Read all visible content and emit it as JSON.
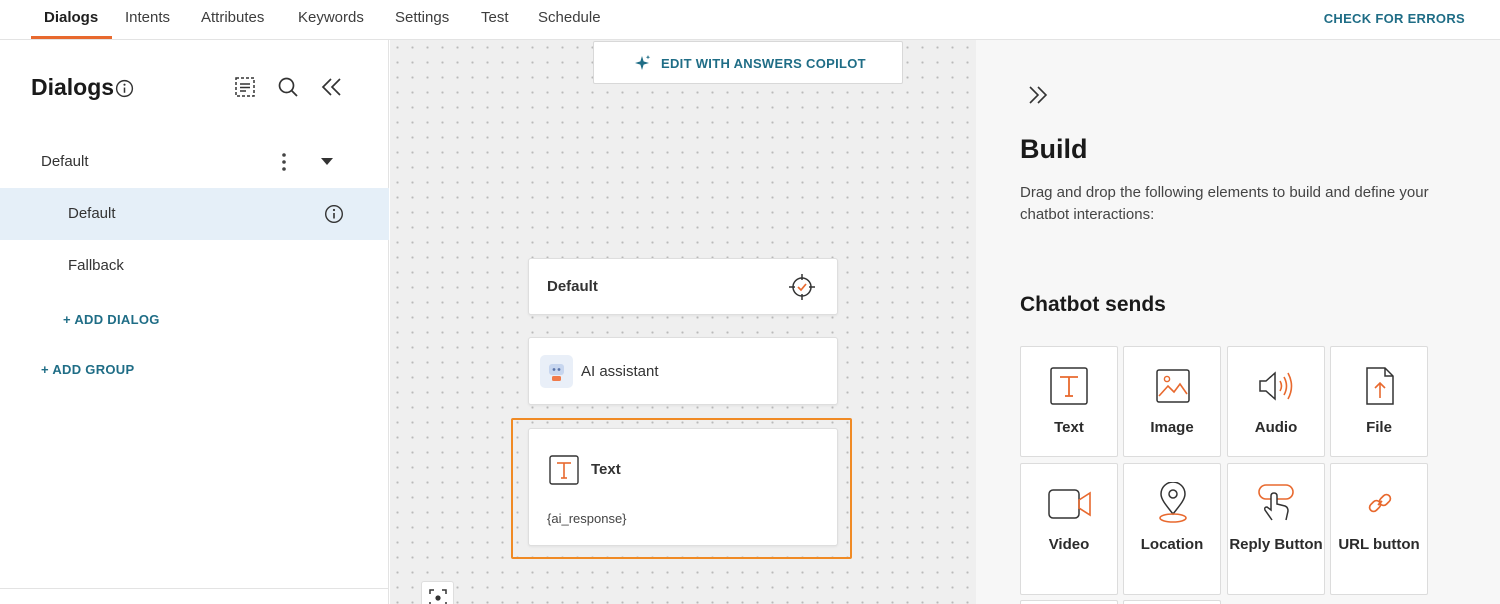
{
  "topnav": {
    "tabs": [
      {
        "label": "Dialogs"
      },
      {
        "label": "Intents"
      },
      {
        "label": "Attributes"
      },
      {
        "label": "Keywords"
      },
      {
        "label": "Settings"
      },
      {
        "label": "Test"
      },
      {
        "label": "Schedule"
      }
    ],
    "active_tab": "Dialogs",
    "check_errors_label": "CHECK FOR ERRORS",
    "accent_color": "#e8692e"
  },
  "sidebar": {
    "title": "Dialogs",
    "header_icons": [
      "info-icon",
      "list-view-icon",
      "search-icon",
      "collapse-left-icon"
    ],
    "group": {
      "label": "Default",
      "icons": [
        "more-vertical-icon",
        "caret-down-icon"
      ]
    },
    "dialogs": [
      {
        "label": "Default",
        "selected": true
      },
      {
        "label": "Fallback",
        "selected": false
      }
    ],
    "add_dialog_label": "+ ADD DIALOG",
    "add_group_label": "+ ADD GROUP"
  },
  "canvas": {
    "copilot_label": "EDIT WITH ANSWERS COPILOT",
    "nodes": {
      "start": {
        "title": "Default"
      },
      "ai": {
        "label": "AI assistant"
      },
      "text": {
        "title": "Text",
        "content": "{ai_response}"
      }
    },
    "selection_color": "#f08a24"
  },
  "panel": {
    "title": "Build",
    "description": "Drag and drop the following elements to build and define your chatbot interactions:",
    "section_title": "Chatbot sends",
    "elements": [
      {
        "label": "Text",
        "icon": "text-icon"
      },
      {
        "label": "Image",
        "icon": "image-icon"
      },
      {
        "label": "Audio",
        "icon": "audio-icon"
      },
      {
        "label": "File",
        "icon": "file-icon"
      },
      {
        "label": "Video",
        "icon": "video-icon"
      },
      {
        "label": "Location",
        "icon": "location-icon"
      },
      {
        "label": "Reply Button",
        "icon": "reply-button-icon"
      },
      {
        "label": "URL button",
        "icon": "url-button-icon"
      }
    ]
  }
}
